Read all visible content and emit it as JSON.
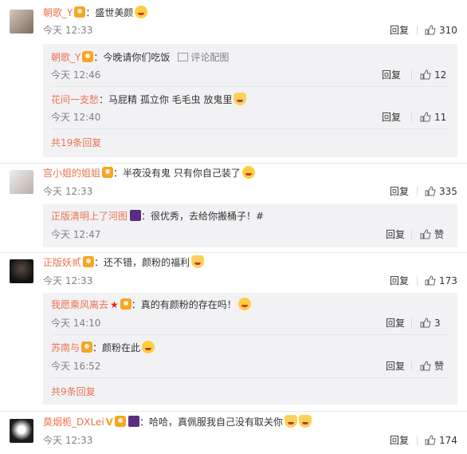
{
  "comments": [
    {
      "user": "朝歌_Y",
      "text": "：盛世美颜",
      "time": "今天 12:33",
      "reply_label": "回复",
      "likes": "310",
      "replies": [
        {
          "user": "朝歌_Y",
          "text": "：今晚请你们吃饭",
          "extra": "评论配图",
          "time": "今天 12:46",
          "reply_label": "回复",
          "likes": "12"
        },
        {
          "user": "花间一支愁",
          "text": "：马屁精  孤立你  毛毛虫  放鬼里",
          "time": "今天 12:40",
          "reply_label": "回复",
          "likes": "11"
        }
      ],
      "more_label": "共19条回复"
    },
    {
      "user": "宫小姐的姐姐",
      "text": "：半夜没有鬼 只有你自己装了",
      "time": "今天 12:33",
      "reply_label": "回复",
      "likes": "335",
      "replies": [
        {
          "user": "正版清明上了河图",
          "text": "：很优秀，去给你搬桶子！#",
          "time": "今天 12:47",
          "reply_label": "回复",
          "likes": "赞"
        }
      ]
    },
    {
      "user": "正版妖贰",
      "text": "：还不错，颜粉的福利",
      "time": "今天 12:33",
      "reply_label": "回复",
      "likes": "173",
      "replies": [
        {
          "user": "我愿乘风离去",
          "text": "：真的有颜粉的存在吗！",
          "time": "今天 14:10",
          "reply_label": "回复",
          "likes": "3"
        },
        {
          "user": "苏南与",
          "text": "：颜粉在此",
          "time": "今天 16:52",
          "reply_label": "回复",
          "likes": "赞"
        }
      ],
      "more_label": "共9条回复"
    },
    {
      "user": "莫烟栀_DXLei",
      "text": "：哈哈，真佩服我自己没有取关你",
      "time": "今天 12:33",
      "reply_label": "回复",
      "likes": "174"
    }
  ],
  "icons": {
    "vip_badge": "vip-crown-icon",
    "thumb": "thumbs-up-icon",
    "image": "image-icon",
    "emoji": "emoji-icon"
  },
  "colors": {
    "username": "#eb7350",
    "time": "#808080",
    "reply_bg": "#f2f2f5"
  }
}
